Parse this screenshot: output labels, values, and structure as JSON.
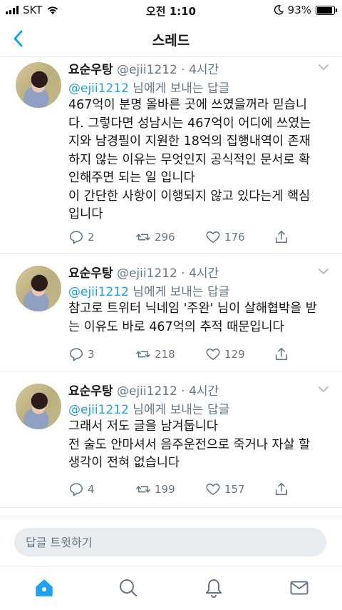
{
  "status": {
    "carrier": "SKT",
    "time": "오전 1:10",
    "battery": "93%"
  },
  "nav": {
    "title": "스레드",
    "back_icon": "chevron-left-icon"
  },
  "tweets": [
    {
      "author": "요순우탕",
      "handle": "@ejii1212",
      "time": "· 4시간",
      "reply_mention": "@ejii1212",
      "reply_suffix": " 님에게 보내는 답글",
      "text": "467억이 분명 올바른 곳에 쓰였을꺼라 믿습니\n다. 그렇다면 성남시는 467억이 어디에 쓰였는\n지와 남경필이 지원한 18억의 집행내역이 존재\n하지 않는 이유는 무엇인지 공식적인 문서로 확\n인해주면 되는 일 입니다\n이 간단한 사항이 이행되지 않고 있다는게 핵심\n입니다",
      "replies": "2",
      "retweets": "296",
      "likes": "176"
    },
    {
      "author": "요순우탕",
      "handle": "@ejii1212",
      "time": "· 4시간",
      "reply_mention": "@ejii1212",
      "reply_suffix": " 님에게 보내는 답글",
      "text": "참고로 트위터 닉네임 '주완' 님이 살해협박을 받\n는 이유도 바로 467억의 추적 때문입니다",
      "replies": "3",
      "retweets": "218",
      "likes": "129"
    },
    {
      "author": "요순우탕",
      "handle": "@ejii1212",
      "time": "· 4시간",
      "reply_mention": "@ejii1212",
      "reply_suffix": " 님에게 보내는 답글",
      "text": "그래서 저도 글을 남겨둡니다\n전 술도 안마셔서 음주운전으로 죽거나 자살 할\n생각이 전혀 없습니다",
      "replies": "4",
      "retweets": "199",
      "likes": "157"
    }
  ],
  "composer": {
    "placeholder": "답글 트윗하기"
  },
  "tabs": [
    "home-icon",
    "search-icon",
    "notifications-icon",
    "messages-icon"
  ],
  "colors": {
    "accent": "#1da1f2",
    "secondary_text": "#657786",
    "divider": "#e1e8ed"
  }
}
